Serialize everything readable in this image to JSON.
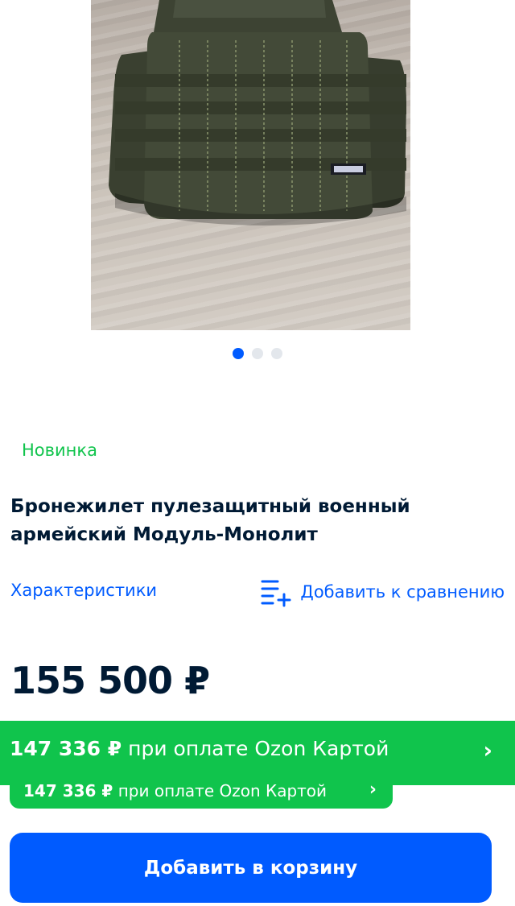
{
  "gallery": {
    "image_description_icon": "product-photo-body-armor-vest",
    "dots": [
      {
        "active": true
      },
      {
        "active": false
      },
      {
        "active": false
      }
    ]
  },
  "product": {
    "badge": "Новинка",
    "title": "Бронежилет пулезащитный военный армейский Модуль-Монолит",
    "specs_link": "Характеристики",
    "compare_link": "Добавить к сравнению",
    "compare_icon": "list-add-icon",
    "price": "155 500 ₽"
  },
  "ozon_offer": {
    "banner_price": "147 336 ₽",
    "banner_text": "при оплате Ozon Картой",
    "pill_price": "147 336 ₽",
    "pill_text": "при оплате Ozon Картой",
    "chevron_icon": "chevron-right-icon"
  },
  "actions": {
    "add_to_cart": "Добавить в корзину"
  },
  "colors": {
    "accent_blue": "#005bff",
    "green": "#10c44c",
    "text_dark": "#001a34"
  }
}
